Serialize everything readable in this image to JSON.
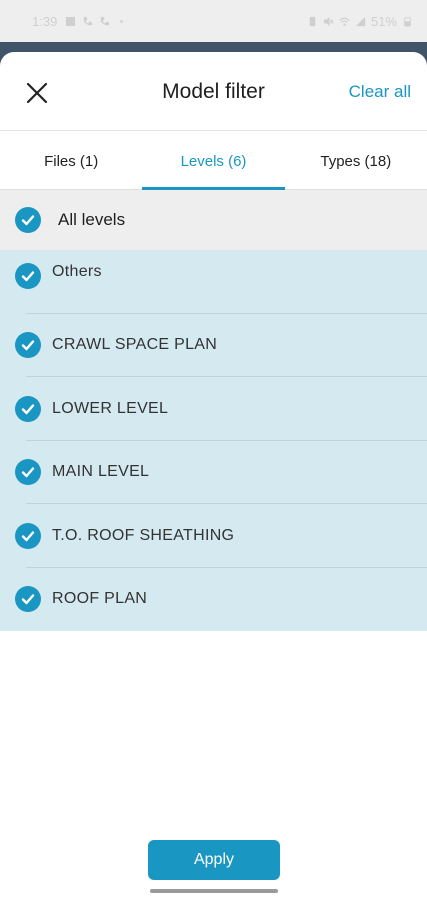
{
  "status_bar": {
    "time": "1:39",
    "battery": "51%",
    "icons_left": [
      "image-icon",
      "phone-icon",
      "phone-icon",
      "dot-icon"
    ],
    "icons_right": [
      "battery-saver-icon",
      "mute-icon",
      "wifi-icon",
      "signal-icon",
      "battery-icon"
    ]
  },
  "header": {
    "title": "Model filter",
    "clear_all": "Clear all",
    "close_icon": "close-icon"
  },
  "tabs": [
    {
      "label": "Files (1)",
      "active": false
    },
    {
      "label": "Levels (6)",
      "active": true
    },
    {
      "label": "Types (18)",
      "active": false
    }
  ],
  "all_levels": {
    "label": "All levels",
    "checked": true
  },
  "levels": [
    {
      "label": "Others",
      "checked": true
    },
    {
      "label": "CRAWL SPACE PLAN",
      "checked": true
    },
    {
      "label": "LOWER LEVEL",
      "checked": true
    },
    {
      "label": "MAIN LEVEL",
      "checked": true
    },
    {
      "label": "T.O. ROOF SHEATHING",
      "checked": true
    },
    {
      "label": "ROOF PLAN",
      "checked": true
    }
  ],
  "apply_label": "Apply",
  "colors": {
    "accent": "#1a96c2",
    "selected_bg": "#d5e9f1",
    "all_row_bg": "#eeeeee"
  }
}
